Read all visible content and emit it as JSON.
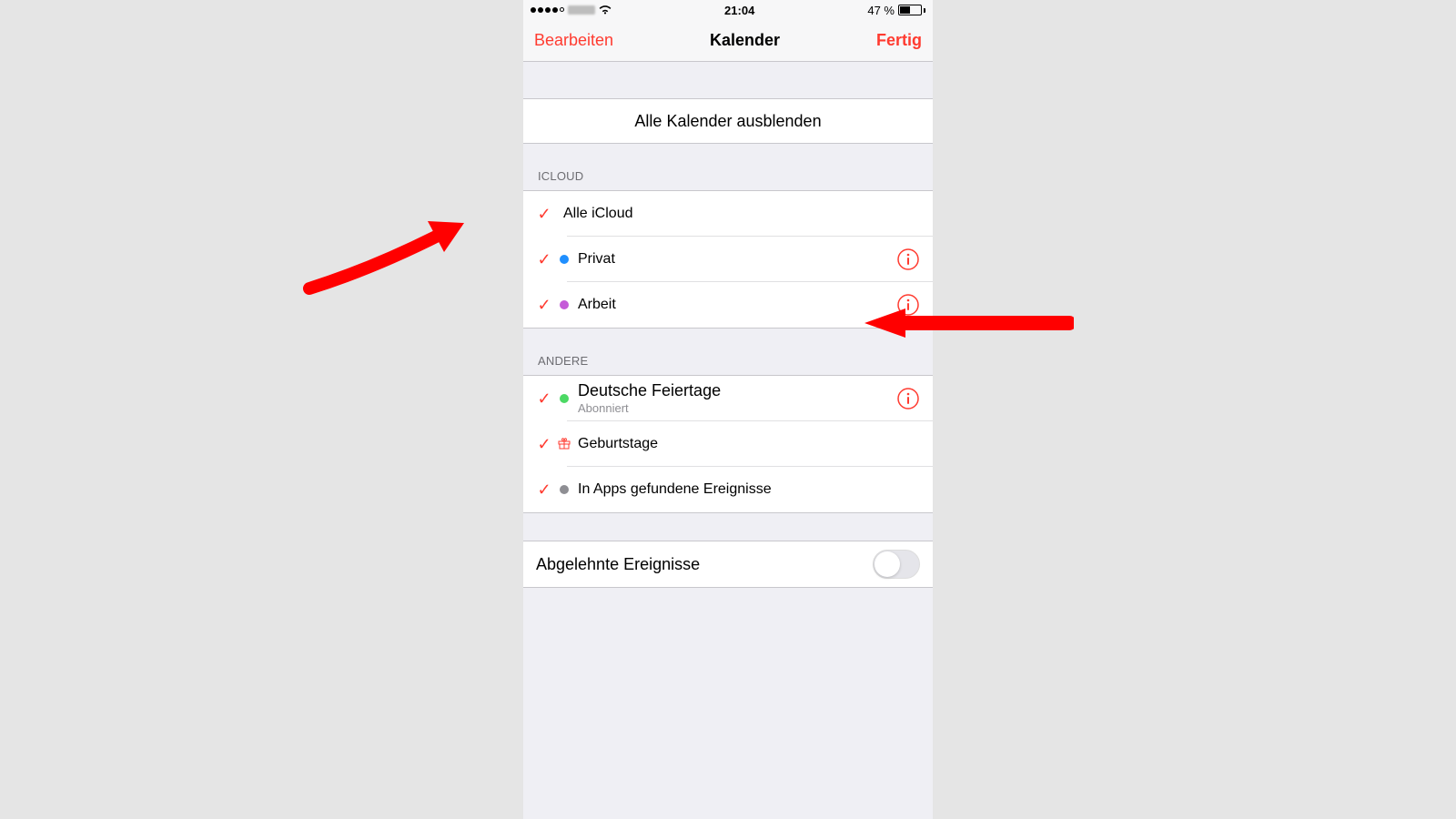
{
  "statusbar": {
    "time": "21:04",
    "battery_text": "47 %"
  },
  "navbar": {
    "left": "Bearbeiten",
    "title": "Kalender",
    "right": "Fertig"
  },
  "actions": {
    "hide_all": "Alle Kalender ausblenden"
  },
  "sections": {
    "icloud": {
      "header": "ICLOUD",
      "all": "Alle iCloud",
      "items": [
        {
          "label": "Privat"
        },
        {
          "label": "Arbeit"
        }
      ]
    },
    "other": {
      "header": "ANDERE",
      "items": [
        {
          "label": "Deutsche Feiertage",
          "sub": "Abonniert"
        },
        {
          "label": "Geburtstage"
        },
        {
          "label": "In Apps gefundene Ereignisse"
        }
      ]
    }
  },
  "declined": {
    "label": "Abgelehnte Ereignisse",
    "on": false
  }
}
